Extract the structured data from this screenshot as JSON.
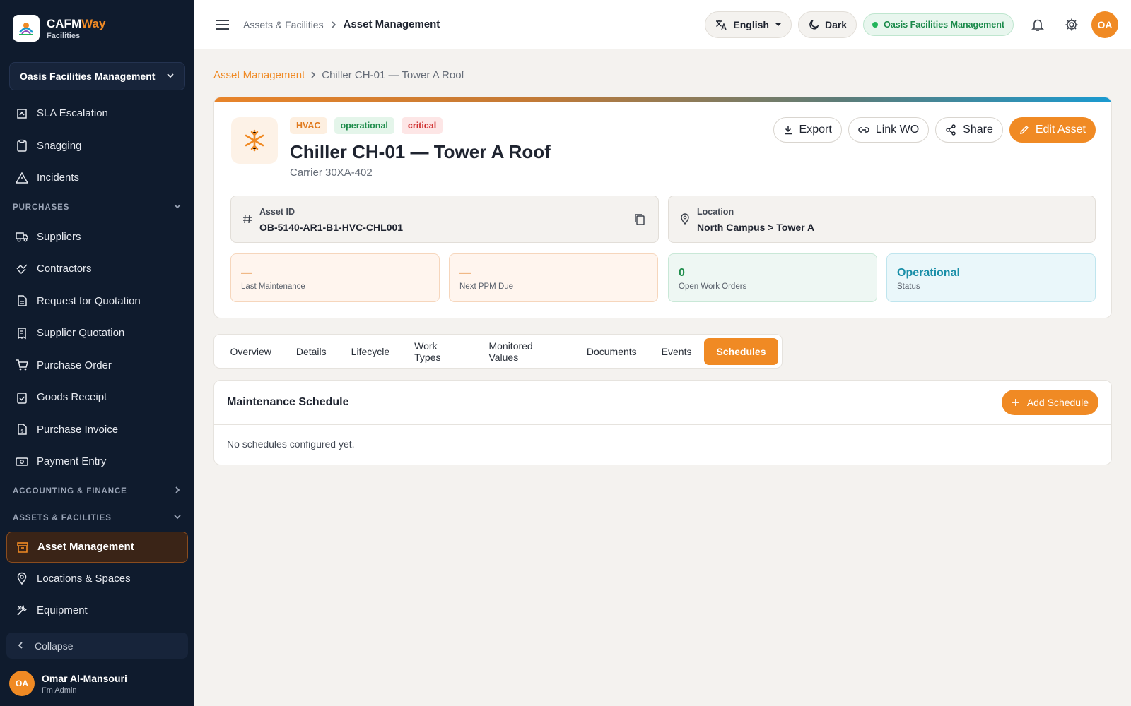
{
  "brand": {
    "name_part1": "CAFM",
    "name_part2": "Way",
    "subtitle": "Facilities"
  },
  "sidebar": {
    "org_selector": "Oasis Facilities Management",
    "items_top": [
      {
        "label": "SLA Escalation",
        "icon": "escalation-icon"
      },
      {
        "label": "Snagging",
        "icon": "clipboard-icon"
      },
      {
        "label": "Incidents",
        "icon": "warning-icon"
      }
    ],
    "purchases_section": "PURCHASES",
    "purchases_items": [
      {
        "label": "Suppliers",
        "icon": "truck-icon"
      },
      {
        "label": "Contractors",
        "icon": "handshake-icon"
      },
      {
        "label": "Request for Quotation",
        "icon": "document-icon"
      },
      {
        "label": "Supplier Quotation",
        "icon": "receipt-icon"
      },
      {
        "label": "Purchase Order",
        "icon": "cart-icon"
      },
      {
        "label": "Goods Receipt",
        "icon": "clipboard-check-icon"
      },
      {
        "label": "Purchase Invoice",
        "icon": "invoice-icon"
      },
      {
        "label": "Payment Entry",
        "icon": "cash-icon"
      }
    ],
    "accounting_section": "ACCOUNTING & FINANCE",
    "assets_section": "ASSETS & FACILITIES",
    "assets_items": [
      {
        "label": "Asset Management",
        "icon": "archive-icon",
        "active": true
      },
      {
        "label": "Locations & Spaces",
        "icon": "pin-icon"
      },
      {
        "label": "Equipment",
        "icon": "tools-icon"
      }
    ],
    "collapse_label": "Collapse",
    "user": {
      "initials": "OA",
      "name": "Omar Al-Mansouri",
      "role": "Fm Admin"
    }
  },
  "topbar": {
    "breadcrumb_parent": "Assets & Facilities",
    "breadcrumb_current": "Asset Management",
    "language": "English",
    "theme": "Dark",
    "org_pill": "Oasis Facilities Management",
    "avatar_initials": "OA"
  },
  "page": {
    "breadcrumb_link": "Asset Management",
    "breadcrumb_current": "Chiller CH-01 — Tower A Roof",
    "badges": {
      "category": "HVAC",
      "status": "operational",
      "criticality": "critical"
    },
    "title": "Chiller CH-01 — Tower A Roof",
    "subtitle": "Carrier 30XA-402",
    "actions": {
      "export": "Export",
      "link_wo": "Link WO",
      "share": "Share",
      "edit": "Edit Asset"
    },
    "asset_id": {
      "label": "Asset ID",
      "value": "OB-5140-AR1-B1-HVC-CHL001"
    },
    "location": {
      "label": "Location",
      "value": "North Campus > Tower A"
    },
    "stats": [
      {
        "value": "—",
        "label": "Last Maintenance"
      },
      {
        "value": "—",
        "label": "Next PPM Due"
      },
      {
        "value": "0",
        "label": "Open Work Orders"
      },
      {
        "value": "Operational",
        "label": "Status"
      }
    ],
    "tabs": [
      "Overview",
      "Details",
      "Lifecycle",
      "Work Types",
      "Monitored Values",
      "Documents",
      "Events",
      "Schedules"
    ],
    "active_tab": "Schedules",
    "schedule": {
      "title": "Maintenance Schedule",
      "add_label": "Add Schedule",
      "empty_text": "No schedules configured yet."
    }
  },
  "colors": {
    "accent": "#f08a24",
    "sidebar_bg": "#0f1b2d",
    "success": "#1f8d4c",
    "danger": "#cf3030"
  }
}
